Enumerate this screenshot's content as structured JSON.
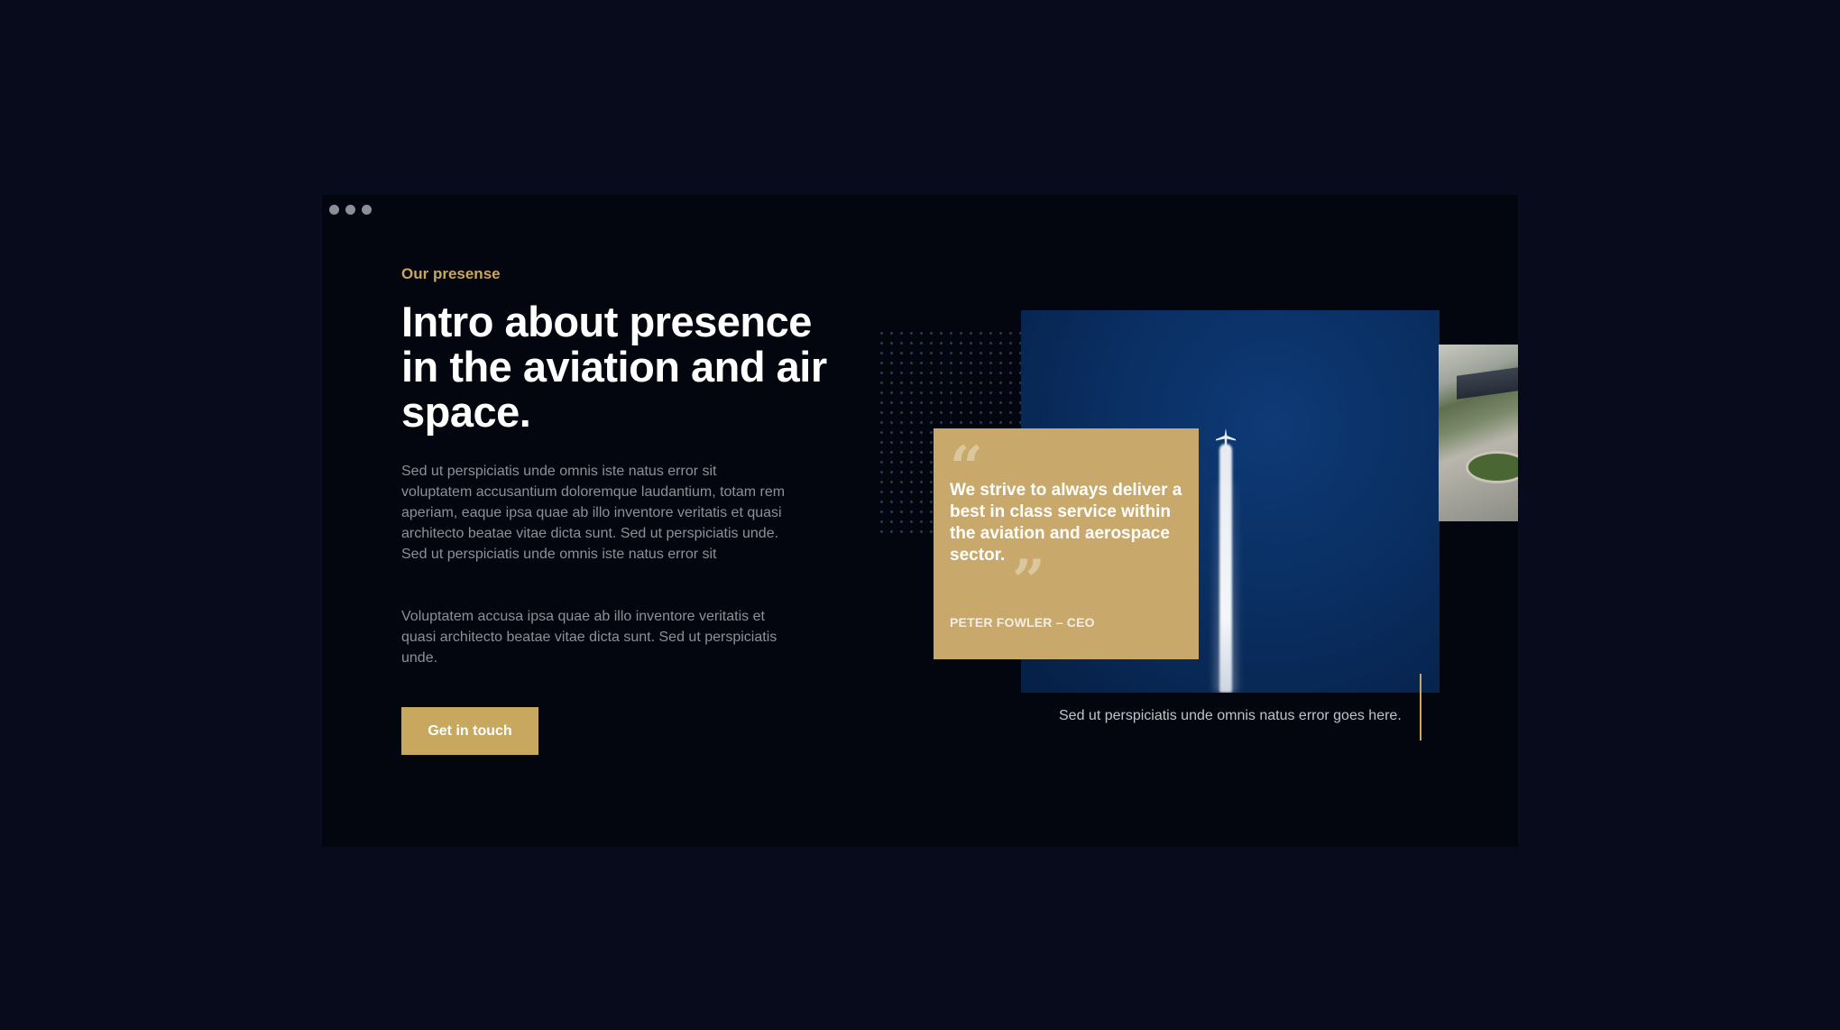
{
  "window": {
    "controls": [
      "dot",
      "dot",
      "dot"
    ]
  },
  "section": {
    "eyebrow": "Our presense",
    "headline": "Intro about presence in the aviation and air space.",
    "paragraph1": "Sed ut perspiciatis unde omnis iste natus error sit voluptatem accusantium doloremque laudantium, totam rem aperiam, eaque ipsa quae ab illo inventore veritatis et quasi architecto beatae vitae dicta sunt. Sed ut perspiciatis unde. Sed ut perspiciatis unde omnis iste natus error sit",
    "paragraph2": "Voluptatem accusa ipsa quae ab illo inventore veritatis et quasi architecto beatae vitae dicta sunt. Sed ut perspiciatis unde.",
    "cta_label": "Get in touch"
  },
  "quote": {
    "open_mark": "“",
    "text": "We strive to always deliver a best in class service within the aviation and aerospace sector.",
    "close_mark": "”",
    "author": "PETER FOWLER – CEO"
  },
  "media": {
    "main_image": "airplane-contrail-photo",
    "side_image": "airport-aerial-photo",
    "caption": "Sed ut perspiciatis unde omnis natus error goes here."
  },
  "colors": {
    "page_background": "#080b1c",
    "window_background": "#03050f",
    "accent_gold": "#c8a85f",
    "sky_blue": "#0a2f63",
    "body_text": "#8d909a"
  }
}
